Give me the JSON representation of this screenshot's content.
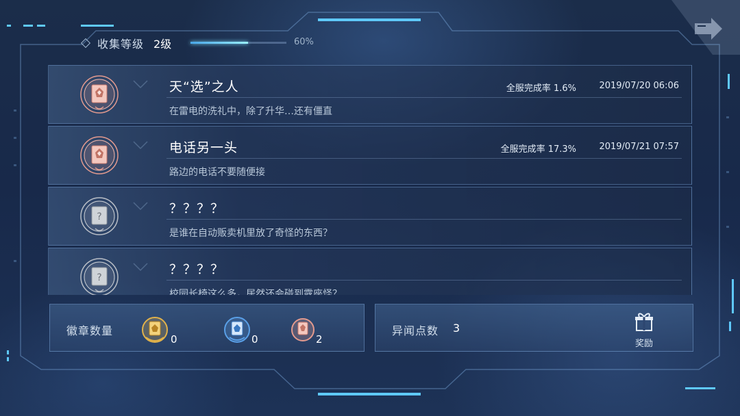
{
  "header": {
    "label": "收集等级",
    "level": "2级",
    "progress": 0.6,
    "progress_text": "60%"
  },
  "achievements": [
    {
      "title": "天“选”之人",
      "desc": "在雷电的洗礼中，除了升华…还有僵直",
      "rate": "全服完成率 1.6%",
      "date": "2019/07/20 06:06",
      "state": "unlocked",
      "icon": "bronze-badge-icon"
    },
    {
      "title": "电话另一头",
      "desc": "路边的电话不要随便接",
      "rate": "全服完成率 17.3%",
      "date": "2019/07/21 07:57",
      "state": "unlocked",
      "icon": "bronze-badge-icon"
    },
    {
      "title": "？？？？",
      "desc": "是谁在自动贩卖机里放了奇怪的东西？",
      "rate": "",
      "date": "",
      "state": "locked",
      "icon": "locked-badge-icon"
    },
    {
      "title": "？？？？",
      "desc": "校园长椅这么多，居然还会碰到露座怪？",
      "rate": "",
      "date": "",
      "state": "locked",
      "icon": "locked-badge-icon"
    }
  ],
  "badges": {
    "label": "徽章数量",
    "items": [
      {
        "name": "gold",
        "count": "0",
        "color": "#e2b24a"
      },
      {
        "name": "blue",
        "count": "0",
        "color": "#5aa0e8"
      },
      {
        "name": "bronze",
        "count": "2",
        "color": "#e39a8e"
      }
    ]
  },
  "oddities": {
    "label": "异闻点数",
    "value": "3"
  },
  "reward": {
    "label": "奖励",
    "icon": "gift-icon"
  },
  "colors": {
    "accent": "#7fe3ff",
    "bronze": "#e39a8e",
    "locked": "#b9bec6"
  }
}
